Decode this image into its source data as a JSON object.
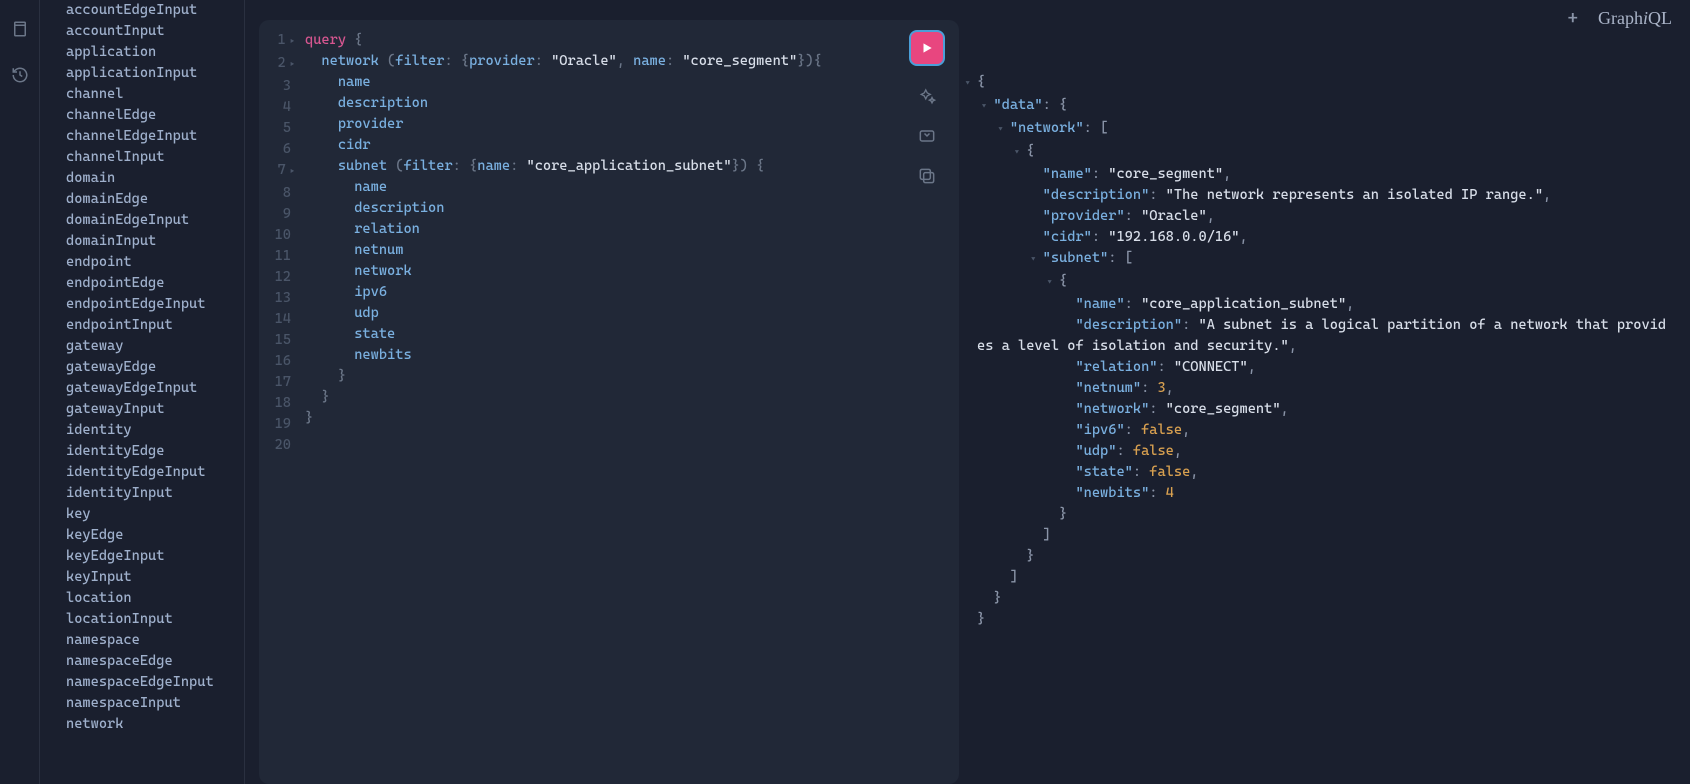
{
  "sidebar": {
    "items": [
      "accountEdgeInput",
      "accountInput",
      "application",
      "applicationInput",
      "channel",
      "channelEdge",
      "channelEdgeInput",
      "channelInput",
      "domain",
      "domainEdge",
      "domainEdgeInput",
      "domainInput",
      "endpoint",
      "endpointEdge",
      "endpointEdgeInput",
      "endpointInput",
      "gateway",
      "gatewayEdge",
      "gatewayEdgeInput",
      "gatewayInput",
      "identity",
      "identityEdge",
      "identityEdgeInput",
      "identityInput",
      "key",
      "keyEdge",
      "keyEdgeInput",
      "keyInput",
      "location",
      "locationInput",
      "namespace",
      "namespaceEdge",
      "namespaceEdgeInput",
      "namespaceInput",
      "network"
    ]
  },
  "editor": {
    "line_count": 20,
    "fold_lines": [
      1,
      2,
      7
    ],
    "query": {
      "keyword": "query",
      "root": {
        "name": "network",
        "filter_kw": "filter",
        "args": [
          {
            "k": "provider",
            "v": "\"Oracle\""
          },
          {
            "k": "name",
            "v": "\"core_segment\""
          }
        ],
        "fields": [
          "name",
          "description",
          "provider",
          "cidr"
        ],
        "child": {
          "name": "subnet",
          "filter_kw": "filter",
          "args": [
            {
              "k": "name",
              "v": "\"core_application_subnet\""
            }
          ],
          "fields": [
            "name",
            "description",
            "relation",
            "netnum",
            "network",
            "ipv6",
            "udp",
            "state",
            "newbits"
          ]
        }
      }
    }
  },
  "response": {
    "data": {
      "network": [
        {
          "name": "core_segment",
          "description": "The network represents an isolated IP range.",
          "provider": "Oracle",
          "cidr": "192.168.0.0/16",
          "subnet": [
            {
              "name": "core_application_subnet",
              "description": "A subnet is a logical partition of a network that provides a level of isolation and security.",
              "relation": "CONNECT",
              "netnum": 3,
              "network": "core_segment",
              "ipv6": false,
              "udp": false,
              "state": false,
              "newbits": 4
            }
          ]
        }
      ]
    }
  },
  "brand": {
    "name_plain": "Graph",
    "name_italic": "i",
    "name_suffix": "QL"
  }
}
